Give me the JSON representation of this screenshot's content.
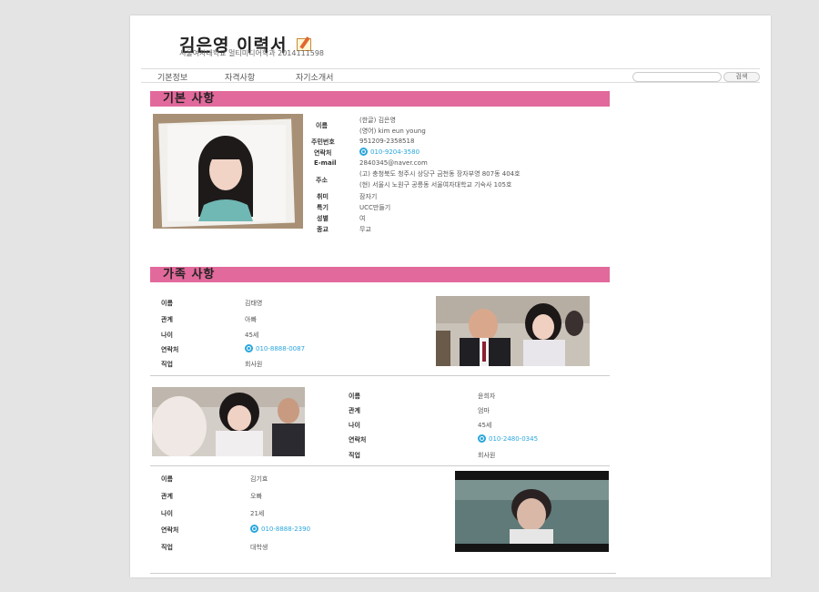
{
  "header": {
    "title": "김은영 이력서",
    "subtitle": "서울여자대학교 멀티미디어학과 2014111598"
  },
  "nav": {
    "items": [
      "기본정보",
      "자격사항",
      "자기소개서"
    ],
    "search_placeholder": "",
    "search_button": "검색"
  },
  "basic": {
    "section_title": "기본 사항",
    "name_label": "이름",
    "name_kor": "(한글) 김은영",
    "name_eng": "(영어) kim eun young",
    "ssn_label": "주민번호",
    "ssn": "951209-2358518",
    "phone_label": "연락처",
    "phone": "010-9204-3580",
    "email_label": "E-mail",
    "email": "2840345@naver.com",
    "addr_label": "주소",
    "addr_home": "(고) 충청북도 청주시 상당구 금천동 장자부영 807동 404호",
    "addr_current": "(현) 서울시 노원구 공릉동 서울여자대학교 기숙사 105호",
    "hobby_label": "취미",
    "hobby": "잠자기",
    "skill_label": "특기",
    "skill": "UCC만들기",
    "gender_label": "성별",
    "gender": "여",
    "religion_label": "종교",
    "religion": "무교"
  },
  "family": {
    "section_title": "가족 사항",
    "labels": {
      "name": "이름",
      "relation": "관계",
      "age": "나이",
      "phone": "연락처",
      "job": "직업"
    },
    "members": [
      {
        "name": "김태영",
        "relation": "아빠",
        "age": "45세",
        "phone": "010-8888-0087",
        "job": "회사원"
      },
      {
        "name": "윤희자",
        "relation": "엄마",
        "age": "45세",
        "phone": "010-2480-0345",
        "job": "회사원"
      },
      {
        "name": "김기효",
        "relation": "오빠",
        "age": "21세",
        "phone": "010-8888-2390",
        "job": "대학생"
      }
    ]
  },
  "colors": {
    "section_bar": "#e2699b",
    "phone_accent": "#2aa6dc"
  }
}
